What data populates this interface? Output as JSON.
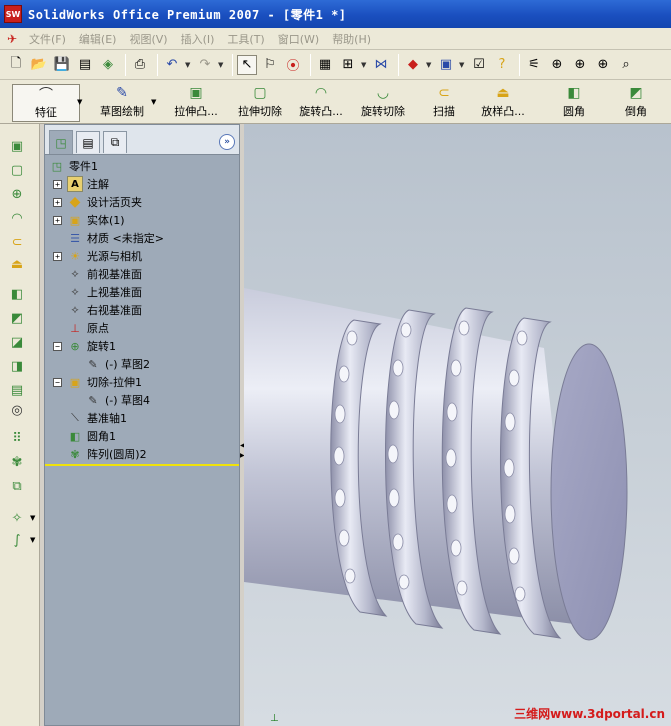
{
  "window": {
    "title": "SolidWorks Office Premium 2007 - [零件1 *]",
    "logo_text": "SW"
  },
  "menu": {
    "items": [
      "文件(F)",
      "编辑(E)",
      "视图(V)",
      "插入(I)",
      "工具(T)",
      "窗口(W)",
      "帮助(H)"
    ]
  },
  "feature_toolbar": {
    "buttons": [
      {
        "label": "特征",
        "icon": "feature-icon"
      },
      {
        "label": "草图绘制",
        "icon": "sketch-icon"
      },
      {
        "label": "拉伸凸...",
        "icon": "extruded-boss-icon"
      },
      {
        "label": "拉伸切除",
        "icon": "extruded-cut-icon"
      },
      {
        "label": "旋转凸...",
        "icon": "revolved-boss-icon"
      },
      {
        "label": "旋转切除",
        "icon": "revolved-cut-icon"
      },
      {
        "label": "扫描",
        "icon": "sweep-icon"
      },
      {
        "label": "放样凸...",
        "icon": "loft-icon"
      },
      {
        "label": "圆角",
        "icon": "fillet-icon"
      },
      {
        "label": "倒角",
        "icon": "chamfer-icon"
      }
    ]
  },
  "feature_tree": {
    "root": "零件1",
    "items": [
      {
        "label": "注解",
        "icon": "annotations-icon",
        "expandable": true
      },
      {
        "label": "设计活页夹",
        "icon": "design-binder-icon",
        "expandable": true
      },
      {
        "label": "实体(1)",
        "icon": "solid-bodies-icon",
        "expandable": true
      },
      {
        "label": "材质 <未指定>",
        "icon": "material-icon",
        "expandable": false
      },
      {
        "label": "光源与相机",
        "icon": "lights-cameras-icon",
        "expandable": true
      },
      {
        "label": "前视基准面",
        "icon": "plane-icon",
        "expandable": false
      },
      {
        "label": "上视基准面",
        "icon": "plane-icon",
        "expandable": false
      },
      {
        "label": "右视基准面",
        "icon": "plane-icon",
        "expandable": false
      },
      {
        "label": "原点",
        "icon": "origin-icon",
        "expandable": false
      },
      {
        "label": "旋转1",
        "icon": "revolve-feature-icon",
        "expandable": true,
        "expanded": true
      },
      {
        "label": "(-) 草图2",
        "icon": "sketch-icon",
        "child": true
      },
      {
        "label": "切除-拉伸1",
        "icon": "cut-extrude-feature-icon",
        "expandable": true,
        "expanded": true
      },
      {
        "label": "(-) 草图4",
        "icon": "sketch-icon",
        "child": true
      },
      {
        "label": "基准轴1",
        "icon": "axis-icon",
        "expandable": false
      },
      {
        "label": "圆角1",
        "icon": "fillet-feature-icon",
        "expandable": false
      },
      {
        "label": "阵列(圆周)2",
        "icon": "circular-pattern-icon",
        "expandable": false
      }
    ]
  },
  "watermark": "三维网www.3dportal.cn",
  "colors": {
    "title_bar": "#1a4fbf",
    "panel_bg": "#9eaab8",
    "viewport_bg": "#c7cfd7",
    "rollback_bar": "#f0e20a",
    "watermark": "#d41b1b"
  }
}
